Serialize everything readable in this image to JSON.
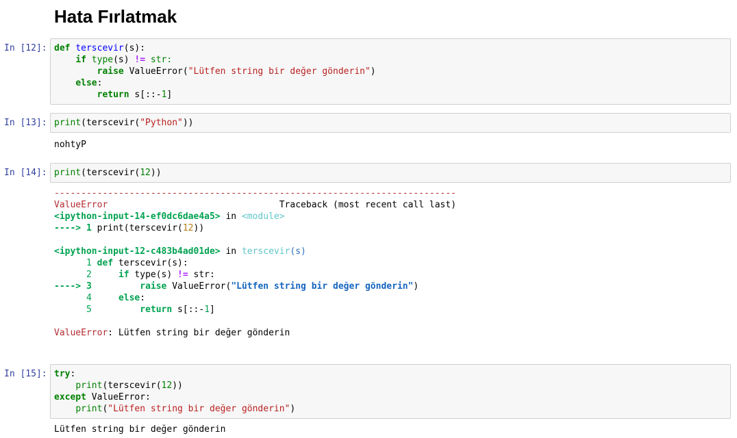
{
  "heading": "Hata Fırlatmak",
  "cells": [
    {
      "prompt": "In [12]:"
    },
    {
      "prompt": "In [13]:",
      "output": "nohtyP"
    },
    {
      "prompt": "In [14]:"
    },
    {
      "prompt": "In [15]:",
      "output": "Lütfen string bir değer gönderin"
    }
  ],
  "code": {
    "c12": {
      "def": "def",
      "fname": "terscevir",
      "param": "(s):",
      "if": "if",
      "type": "type",
      "type_arg": "(s) ",
      "neq": "!=",
      "str": " str:",
      "raise": "raise",
      "exc": " ValueError(",
      "msg": "\"Lütfen string bir değer gönderin\"",
      "close": ")",
      "else": "else",
      "colon": ":",
      "return": "return",
      "ret_a": " s[::-",
      "ret_n": "1",
      "ret_b": "]"
    },
    "c13": {
      "print": "print",
      "a": "(terscevir(",
      "s": "\"Python\"",
      "b": "))"
    },
    "c14": {
      "print": "print",
      "a": "(terscevir(",
      "n": "12",
      "b": "))"
    },
    "c15": {
      "try": "try",
      "colon": ":",
      "print": "print",
      "a": "(terscevir(",
      "n": "12",
      "b": "))",
      "except": "except",
      "exc": " ValueError:",
      "print2": "print",
      "p2a": "(",
      "msg": "\"Lütfen string bir değer gönderin\"",
      "p2b": ")"
    }
  },
  "traceback": {
    "dashes": "---------------------------------------------------------------------------",
    "error_name": "ValueError",
    "header_right": "Traceback (most recent call last)",
    "frame1_file": "<ipython-input-14-ef0dc6dae4a5>",
    "in": "in",
    "frame1_fn": "<module>",
    "frame1_arrow": "----> 1 ",
    "frame1_code_a": "print(terscevir(",
    "frame1_code_n": "12",
    "frame1_code_b": "))",
    "frame2_file": "<ipython-input-12-c483b4ad01de>",
    "frame2_fn": "terscevir",
    "frame2_args": "(s)",
    "l1_no": "1",
    "l1_def": "def",
    "l1_rest": " terscevir(s):",
    "l2_no": "2",
    "l2_if": "if",
    "l2_type": " type(s) ",
    "l2_neq": "!=",
    "l2_str": " str:",
    "l3_arrow": "----> 3",
    "l3_raise": "raise",
    "l3_exc": " ValueError(",
    "l3_msg": "\"Lütfen string bir değer gönderin\"",
    "l3_close": ")",
    "l4_no": "4",
    "l4_else": "else",
    "l4_colon": ":",
    "l5_no": "5",
    "l5_return": "return",
    "l5_a": " s[::-",
    "l5_n": "1",
    "l5_b": "]",
    "final_name": "ValueError",
    "final_msg": ": Lütfen string bir değer gönderin"
  }
}
